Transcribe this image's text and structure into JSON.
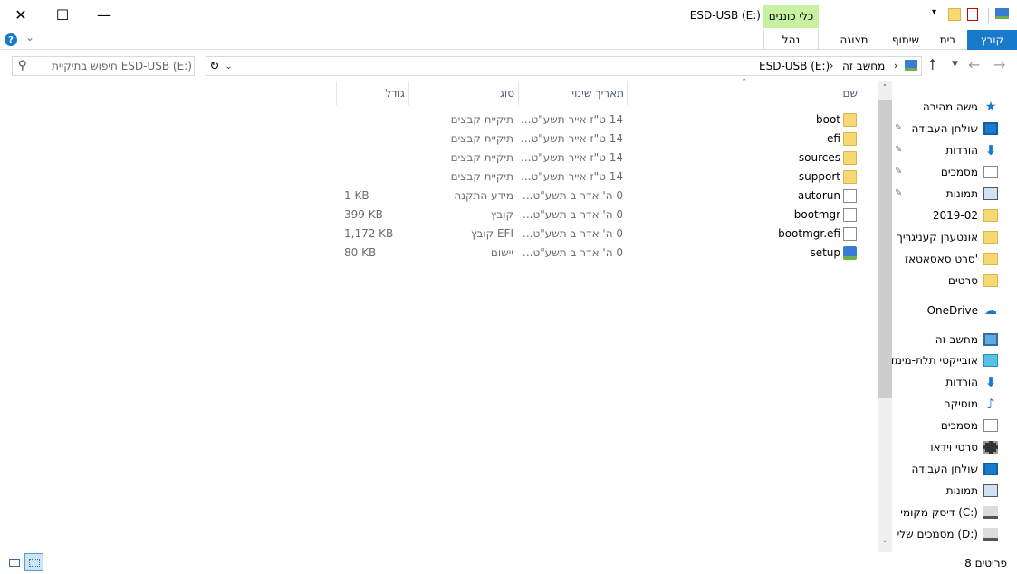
{
  "window": {
    "title": "ESD-USB (E:)",
    "contextual_tab_group": "כלי כוננים",
    "controls": {
      "close": "✕",
      "maximize": "☐",
      "minimize": "—"
    }
  },
  "ribbon": {
    "tabs": {
      "file": "קובץ",
      "home": "בית",
      "share": "שיתוף",
      "view": "תצוגה",
      "manage": "נהל"
    },
    "help": "?",
    "expand": "⌄"
  },
  "address": {
    "breadcrumb": [
      "מחשב זה",
      "ESD-USB (E:)"
    ],
    "separator": "›",
    "search_placeholder": "חיפוש בתיקיית ESD-USB (E:)"
  },
  "columns": {
    "name": "שם",
    "date": "תאריך שינוי",
    "type": "סוג",
    "size": "גודל"
  },
  "files": [
    {
      "name": "boot",
      "date": "14 ט\"ז אייר תשע\"ט...",
      "type": "תיקיית קבצים",
      "size": "",
      "icon": "folder"
    },
    {
      "name": "efi",
      "date": "14 ט\"ז אייר תשע\"ט...",
      "type": "תיקיית קבצים",
      "size": "",
      "icon": "folder"
    },
    {
      "name": "sources",
      "date": "14 ט\"ז אייר תשע\"ט...",
      "type": "תיקיית קבצים",
      "size": "",
      "icon": "folder"
    },
    {
      "name": "support",
      "date": "14 ט\"ז אייר תשע\"ט...",
      "type": "תיקיית קבצים",
      "size": "",
      "icon": "folder"
    },
    {
      "name": "autorun",
      "date": "0 ה' אדר ב תשע\"ט...",
      "type": "מידע התקנה",
      "size": "1 KB",
      "icon": "inf"
    },
    {
      "name": "bootmgr",
      "date": "0 ה' אדר ב תשע\"ט...",
      "type": "קובץ",
      "size": "399 KB",
      "icon": "file"
    },
    {
      "name": "bootmgr.efi",
      "date": "0 ה' אדר ב תשע\"ט...",
      "type": "קובץ EFI",
      "size": "1,172 KB",
      "icon": "file"
    },
    {
      "name": "setup",
      "date": "0 ה' אדר ב תשע\"ט...",
      "type": "יישום",
      "size": "80 KB",
      "icon": "app"
    }
  ],
  "sidebar": {
    "quick_access": {
      "label": "גישה מהירה",
      "icon": "star-icon"
    },
    "quick_items": [
      {
        "label": "שולחן העבודה",
        "icon": "desktop",
        "pinned": true
      },
      {
        "label": "הורדות",
        "icon": "download",
        "pinned": true
      },
      {
        "label": "מסמכים",
        "icon": "document",
        "pinned": true
      },
      {
        "label": "תמונות",
        "icon": "pictures",
        "pinned": true
      },
      {
        "label": "2019-02",
        "icon": "folder",
        "pinned": false
      },
      {
        "label": "אונטערן קעניגריך",
        "icon": "folder",
        "pinned": false
      },
      {
        "label": "סרט סאסאטאז'",
        "icon": "folder",
        "pinned": false
      },
      {
        "label": "סרטים",
        "icon": "folder",
        "pinned": false
      }
    ],
    "onedrive": {
      "label": "OneDrive",
      "icon": "cloud"
    },
    "this_pc": {
      "label": "מחשב זה",
      "icon": "computer"
    },
    "pc_items": [
      {
        "label": "אובייקטי תלת-מימד",
        "icon": "3d"
      },
      {
        "label": "הורדות",
        "icon": "download"
      },
      {
        "label": "מוסיקה",
        "icon": "music"
      },
      {
        "label": "מסמכים",
        "icon": "document"
      },
      {
        "label": "סרטי וידאו",
        "icon": "video"
      },
      {
        "label": "שולחן העבודה",
        "icon": "desktop"
      },
      {
        "label": "תמונות",
        "icon": "pictures"
      },
      {
        "label": "דיסק מקומי (C:)",
        "icon": "drive"
      },
      {
        "label": "מסמכים שלי (D:)",
        "icon": "drive"
      }
    ]
  },
  "status": {
    "item_count": "8 פריטים"
  },
  "colors": {
    "accent": "#1979ca",
    "context_tab": "#c7f0a2",
    "folder": "#f8d775"
  }
}
